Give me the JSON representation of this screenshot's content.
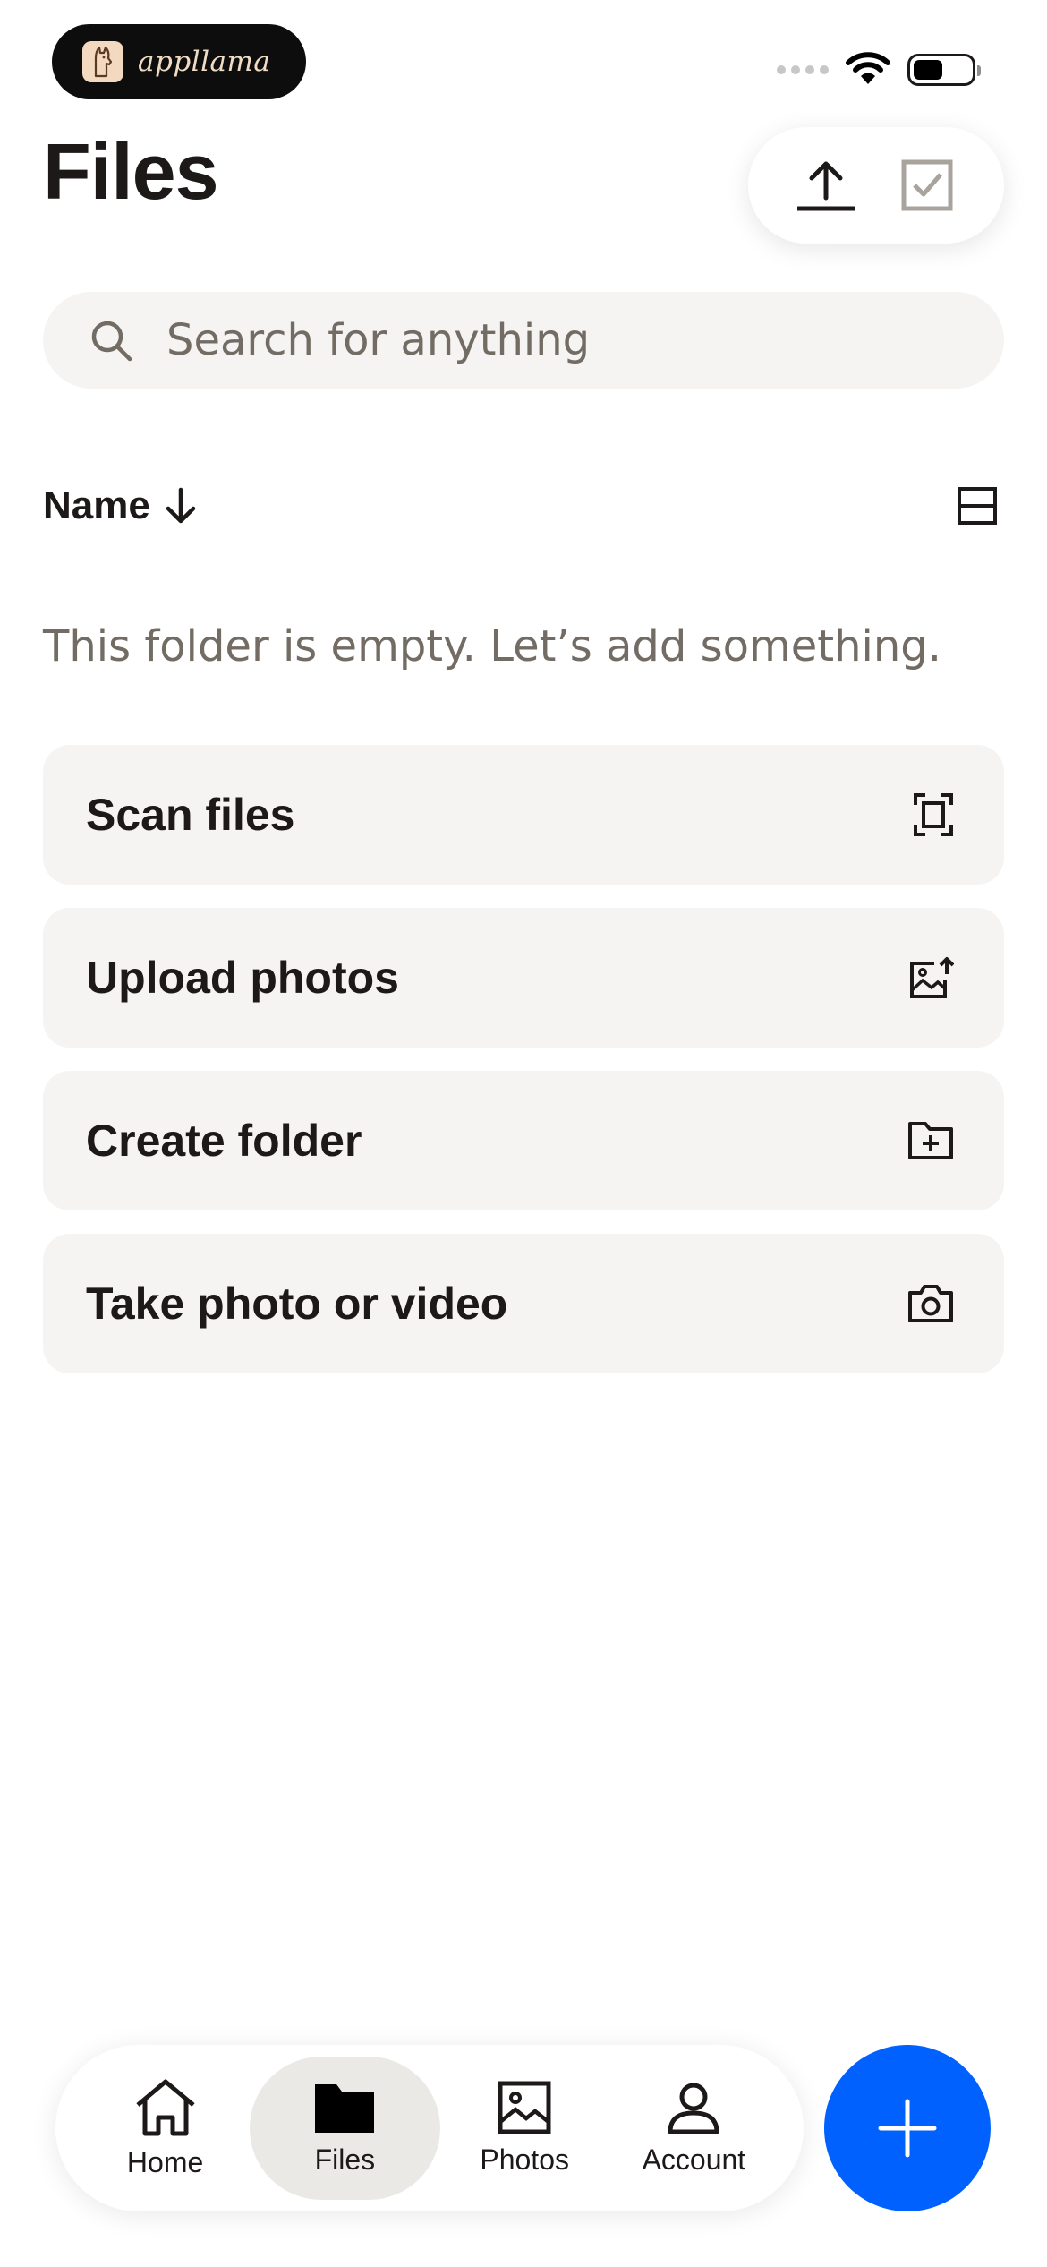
{
  "status_bar": {
    "brand": "appllama",
    "icons": [
      "signal-dots-icon",
      "wifi-icon",
      "battery-icon"
    ]
  },
  "header": {
    "title": "Files",
    "actions": [
      "upload-icon",
      "select-checkbox-icon"
    ]
  },
  "search": {
    "placeholder": "Search for anything"
  },
  "sort": {
    "label": "Name",
    "direction_icon": "arrow-down-icon",
    "view_icon": "layout-toggle-icon"
  },
  "empty_message": "This folder is empty. Let’s add something.",
  "actions": [
    {
      "label": "Scan files",
      "icon": "scan-icon"
    },
    {
      "label": "Upload photos",
      "icon": "upload-photo-icon"
    },
    {
      "label": "Create folder",
      "icon": "folder-plus-icon"
    },
    {
      "label": "Take photo or video",
      "icon": "camera-icon"
    }
  ],
  "nav": {
    "items": [
      {
        "label": "Home",
        "icon": "home-icon"
      },
      {
        "label": "Files",
        "icon": "folder-icon",
        "active": true
      },
      {
        "label": "Photos",
        "icon": "photo-icon"
      },
      {
        "label": "Account",
        "icon": "person-icon"
      }
    ],
    "fab_icon": "plus-icon"
  },
  "colors": {
    "accent": "#0061fe",
    "text": "#1e1919",
    "muted": "#736c64",
    "surface": "#f5f4f2"
  }
}
